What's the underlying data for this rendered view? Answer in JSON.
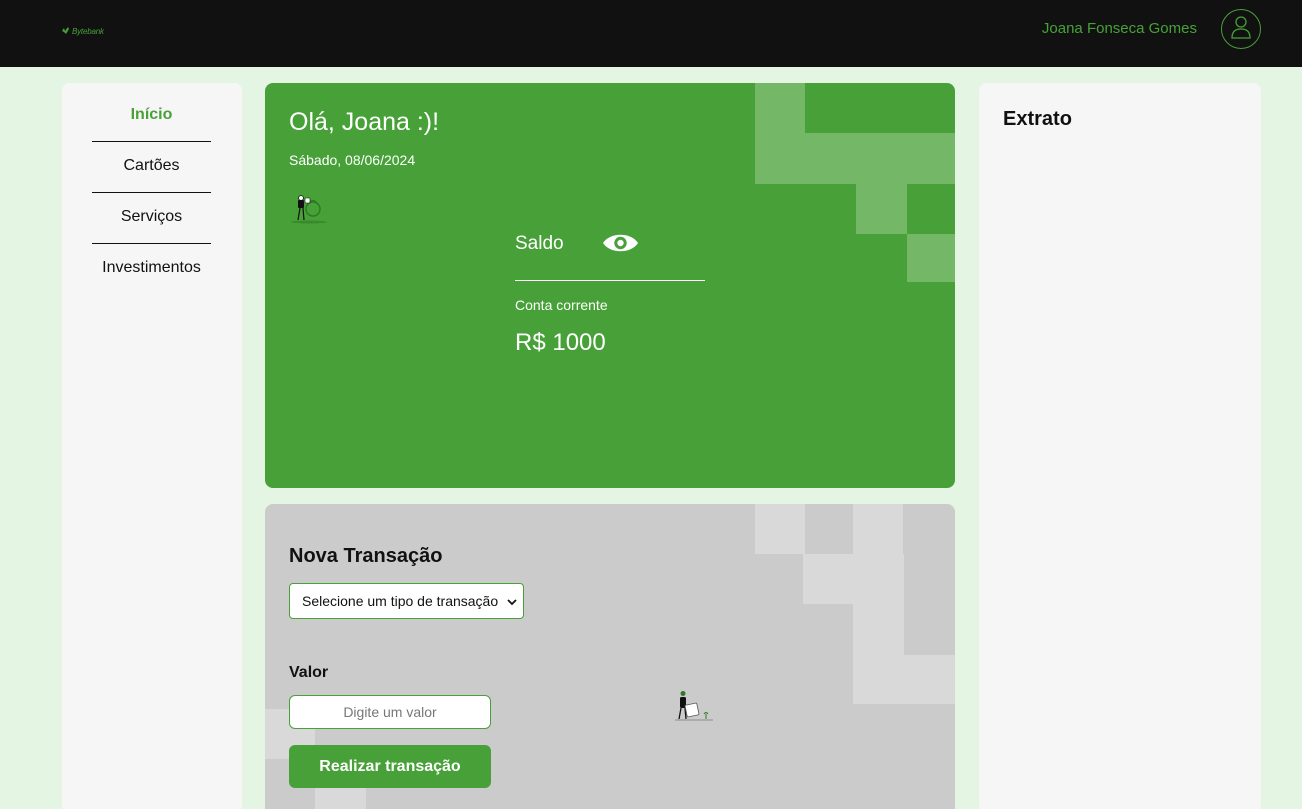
{
  "header": {
    "logo_text": "Bytebank",
    "user_name": "Joana Fonseca Gomes",
    "avatar_icon": "user-icon"
  },
  "sidebar": {
    "items": [
      {
        "label": "Início",
        "active": true
      },
      {
        "label": "Cartões",
        "active": false
      },
      {
        "label": "Serviços",
        "active": false
      },
      {
        "label": "Investimentos",
        "active": false
      }
    ]
  },
  "balance": {
    "greeting": "Olá, Joana :)!",
    "date": "Sábado, 08/06/2024",
    "label": "Saldo",
    "visibility_icon": "eye-icon",
    "account_type": "Conta corrente",
    "amount": "R$ 1000"
  },
  "transaction": {
    "title": "Nova Transação",
    "select_value": "Selecione um tipo de transação",
    "value_label": "Valor",
    "value_placeholder": "Digite um valor",
    "submit_label": "Realizar transação"
  },
  "statement": {
    "title": "Extrato"
  },
  "colors": {
    "brand_green": "#47a138",
    "header_bg": "#111111",
    "page_bg": "#e4f5e4",
    "panel_bg": "#f6f6f6",
    "transaction_bg": "#cbcbcb"
  }
}
